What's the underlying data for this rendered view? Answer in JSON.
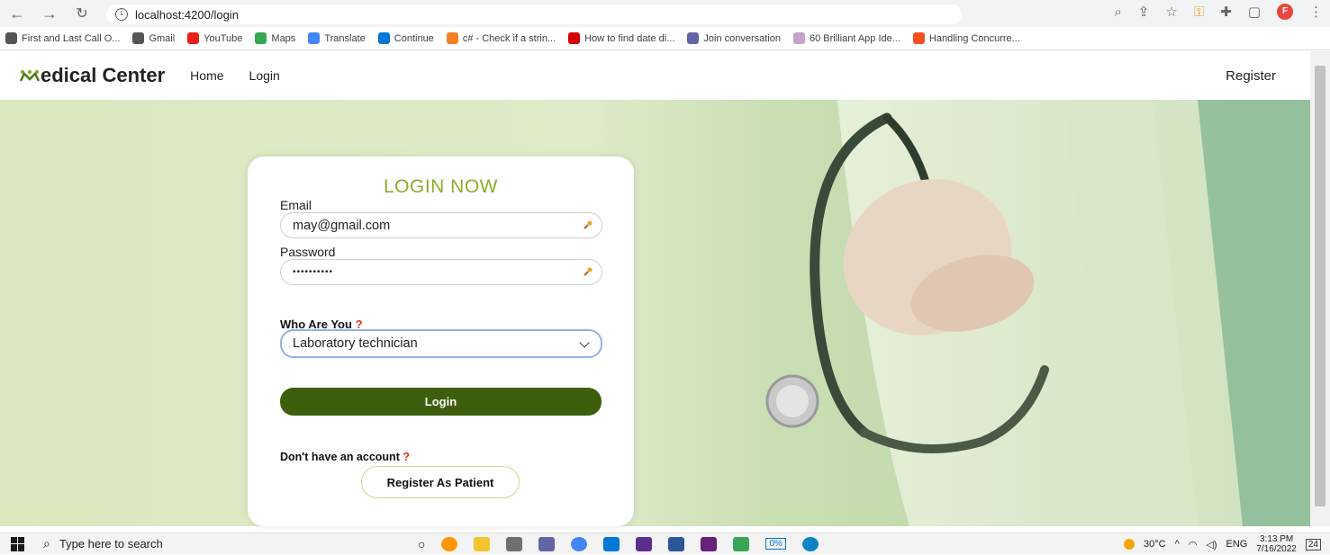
{
  "browser": {
    "url": "localhost:4200/login",
    "bookmarks": [
      {
        "label": "First and Last Call O...",
        "color": "#555555"
      },
      {
        "label": "Gmail",
        "color": "#555555"
      },
      {
        "label": "YouTube",
        "color": "#e62117"
      },
      {
        "label": "Maps",
        "color": "#34a853"
      },
      {
        "label": "Translate",
        "color": "#4285f4"
      },
      {
        "label": "Continue",
        "color": "#0078d4"
      },
      {
        "label": "c# - Check if a strin...",
        "color": "#f48024"
      },
      {
        "label": "How to find date di...",
        "color": "#d50000"
      },
      {
        "label": "Join conversation",
        "color": "#6264a7"
      },
      {
        "label": "60 Brilliant App Ide...",
        "color": "#c8a2c8"
      },
      {
        "label": "Handling Concurre...",
        "color": "#f25022"
      }
    ],
    "profile_initial": "F"
  },
  "navbar": {
    "brand": "edical Center",
    "links": [
      "Home",
      "Login"
    ],
    "register": "Register"
  },
  "login": {
    "title": "LOGIN NOW",
    "email_label": "Email",
    "email_value": "may@gmail.com",
    "password_label": "Password",
    "password_value": "••••••••••",
    "who_label": "Who Are You",
    "who_mark": "?",
    "role_selected": "Laboratory technician",
    "login_button": "Login",
    "no_account": "Don't have an account",
    "no_account_mark": "?",
    "register_patient_button": "Register As Patient"
  },
  "taskbar": {
    "search_placeholder": "Type here to search",
    "weather": "30°C",
    "lang": "ENG",
    "time": "3:13 PM",
    "date": "7/16/2022",
    "battery": "0%",
    "notifications": "24"
  },
  "colors": {
    "accent": "#8bad2e",
    "button": "#3d5f0d",
    "question": "#e0301e"
  }
}
